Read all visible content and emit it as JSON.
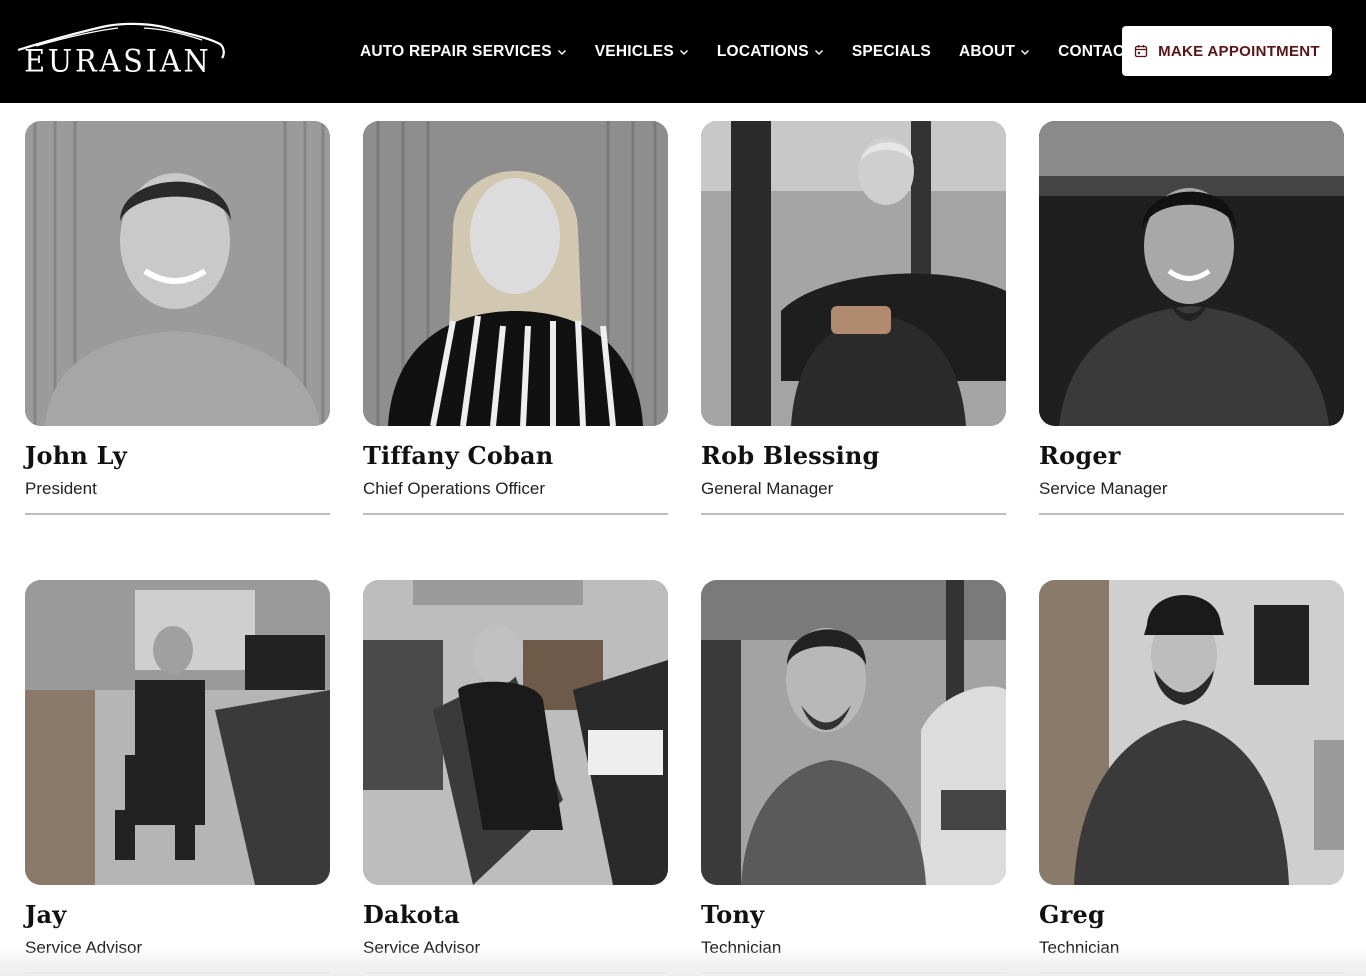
{
  "brand": {
    "logo_text": "EURASIAN"
  },
  "nav": {
    "items": [
      {
        "label": "AUTO REPAIR SERVICES",
        "has_dropdown": true
      },
      {
        "label": "VEHICLES",
        "has_dropdown": true
      },
      {
        "label": "LOCATIONS",
        "has_dropdown": true
      },
      {
        "label": "SPECIALS",
        "has_dropdown": false
      },
      {
        "label": "ABOUT",
        "has_dropdown": true
      },
      {
        "label": "CONTACT",
        "has_dropdown": false
      }
    ],
    "cta_label": "MAKE APPOINTMENT",
    "cta_icon": "calendar-icon"
  },
  "team": [
    {
      "name": "John Ly",
      "role": "President"
    },
    {
      "name": "Tiffany Coban",
      "role": "Chief Operations Officer"
    },
    {
      "name": "Rob Blessing",
      "role": "General Manager"
    },
    {
      "name": "Roger",
      "role": "Service Manager"
    },
    {
      "name": "Jay",
      "role": "Service Advisor"
    },
    {
      "name": "Dakota",
      "role": "Service Advisor"
    },
    {
      "name": "Tony",
      "role": "Technician"
    },
    {
      "name": "Greg",
      "role": "Technician"
    }
  ],
  "colors": {
    "header_bg": "#000000",
    "cta_text": "#5a1416",
    "rule": "#bdbdbd"
  }
}
